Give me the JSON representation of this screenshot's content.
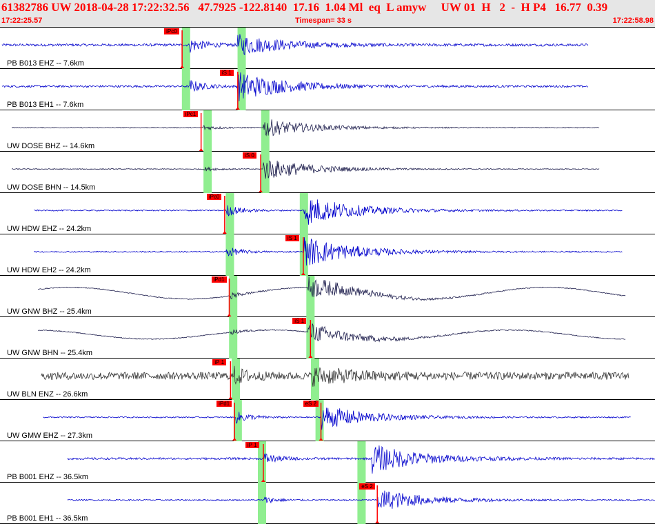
{
  "header": {
    "title_line": "61382786 UW 2018-04-28 17:22:32.56   47.7925 -122.8140  17.16  1.04 Ml  eq  L amyw     UW 01  H   2  -  H P4   16.77  0.39",
    "time_start": "17:22:25.57",
    "timespan": "Timespan=  33 s",
    "time_end": "17:22:58.98"
  },
  "colors": {
    "header_bg": "#e6e6e6",
    "header_text": "#ff0000",
    "trace_blue": "#0000cc",
    "trace_dark": "#1a1a4a",
    "trace_gray": "#333333",
    "pick_marker": "#ff0000",
    "window_green": "#90ee90"
  },
  "traces": [
    {
      "label": "PB B013 EHZ -- 7.6km",
      "color": "trace_blue",
      "p_pick": {
        "tag": "iPc0",
        "t": 0.278
      },
      "s_pick": null,
      "windows": [
        0.284,
        0.369
      ],
      "start": 0.003,
      "end": 0.898,
      "p_time": 0.29,
      "s_time": 0.362,
      "p_amp": 0.35,
      "s_amp": 0.5,
      "noise": 0.06,
      "wave": 0
    },
    {
      "label": "PB B013 EH1 -- 7.6km",
      "color": "trace_blue",
      "p_pick": null,
      "s_pick": {
        "tag": "iS 1",
        "t": 0.363
      },
      "windows": [
        0.284,
        0.369
      ],
      "start": 0.003,
      "end": 0.898,
      "p_time": 0.29,
      "s_time": 0.362,
      "p_amp": 0.3,
      "s_amp": 0.7,
      "noise": 0.05,
      "wave": 0
    },
    {
      "label": "UW DOSE BHZ -- 14.6km",
      "color": "trace_dark",
      "p_pick": {
        "tag": "iPc1",
        "t": 0.307
      },
      "s_pick": null,
      "windows": [
        0.317,
        0.405
      ],
      "start": 0.018,
      "end": 0.915,
      "p_time": 0.31,
      "s_time": 0.402,
      "p_amp": 0.12,
      "s_amp": 0.45,
      "noise": 0.02,
      "wave": 0
    },
    {
      "label": "UW DOSE BHN -- 14.5km",
      "color": "trace_dark",
      "p_pick": null,
      "s_pick": {
        "tag": "iS 0",
        "t": 0.398
      },
      "windows": [
        0.317,
        0.405
      ],
      "start": 0.018,
      "end": 0.915,
      "p_time": 0.31,
      "s_time": 0.402,
      "p_amp": 0.1,
      "s_amp": 0.55,
      "noise": 0.02,
      "wave": 0
    },
    {
      "label": "UW HDW EHZ -- 24.2km",
      "color": "trace_blue",
      "p_pick": {
        "tag": "iPc0",
        "t": 0.343
      },
      "s_pick": null,
      "windows": [
        0.351,
        0.464
      ],
      "start": 0.052,
      "end": 0.95,
      "p_time": 0.345,
      "s_time": 0.464,
      "p_amp": 0.3,
      "s_amp": 0.75,
      "noise": 0.03,
      "wave": 0
    },
    {
      "label": "UW HDW EH2 -- 24.2km",
      "color": "trace_blue",
      "p_pick": null,
      "s_pick": {
        "tag": "iS 1",
        "t": 0.463
      },
      "windows": [
        0.351,
        0.464
      ],
      "start": 0.052,
      "end": 0.95,
      "p_time": 0.345,
      "s_time": 0.464,
      "p_amp": 0.25,
      "s_amp": 0.75,
      "noise": 0.03,
      "wave": 0
    },
    {
      "label": "UW GNW BHZ -- 25.4km",
      "color": "trace_dark",
      "p_pick": {
        "tag": "iPd1",
        "t": 0.35
      },
      "s_pick": null,
      "windows": [
        0.356,
        0.474
      ],
      "start": 0.058,
      "end": 0.955,
      "p_time": 0.352,
      "s_time": 0.47,
      "p_amp": 0.15,
      "s_amp": 0.55,
      "noise": 0.02,
      "wave": 0.28
    },
    {
      "label": "UW GNW BHN -- 25.4km",
      "color": "trace_dark",
      "p_pick": null,
      "s_pick": {
        "tag": "iS 1",
        "t": 0.474
      },
      "windows": [
        0.356,
        0.474
      ],
      "start": 0.058,
      "end": 0.955,
      "p_time": 0.352,
      "s_time": 0.47,
      "p_amp": 0.12,
      "s_amp": 0.5,
      "noise": 0.02,
      "wave": 0.22
    },
    {
      "label": "UW BLN ENZ -- 26.6km",
      "color": "trace_gray",
      "p_pick": {
        "tag": "iP 1",
        "t": 0.352
      },
      "s_pick": null,
      "windows": [
        0.36,
        0.481
      ],
      "start": 0.063,
      "end": 0.96,
      "p_time": 0.356,
      "s_time": 0.476,
      "p_amp": 0.35,
      "s_amp": 0.35,
      "noise": 0.18,
      "wave": 0
    },
    {
      "label": "UW GMW EHZ -- 27.3km",
      "color": "trace_blue",
      "p_pick": {
        "tag": "iPd1",
        "t": 0.358
      },
      "s_pick": {
        "tag": "eS 2",
        "t": 0.49
      },
      "windows": [
        0.363,
        0.488
      ],
      "start": 0.066,
      "end": 0.963,
      "p_time": 0.36,
      "s_time": 0.49,
      "p_amp": 0.3,
      "s_amp": 0.6,
      "noise": 0.03,
      "wave": 0
    },
    {
      "label": "PB B001 EHZ -- 36.5km",
      "color": "trace_blue",
      "p_pick": {
        "tag": "iP 1",
        "t": 0.402
      },
      "s_pick": null,
      "windows": [
        0.4,
        0.552
      ],
      "start": 0.103,
      "end": 1.0,
      "p_time": 0.404,
      "s_time": 0.568,
      "p_amp": 0.25,
      "s_amp": 0.7,
      "noise": 0.05,
      "wave": 0
    },
    {
      "label": "PB B001 EH1 -- 36.5km",
      "color": "trace_blue",
      "p_pick": null,
      "s_pick": {
        "tag": "eS 2",
        "t": 0.576
      },
      "windows": [
        0.4,
        0.552
      ],
      "start": 0.103,
      "end": 1.0,
      "p_time": 0.404,
      "s_time": 0.576,
      "p_amp": 0.15,
      "s_amp": 0.55,
      "noise": 0.03,
      "wave": 0
    }
  ]
}
